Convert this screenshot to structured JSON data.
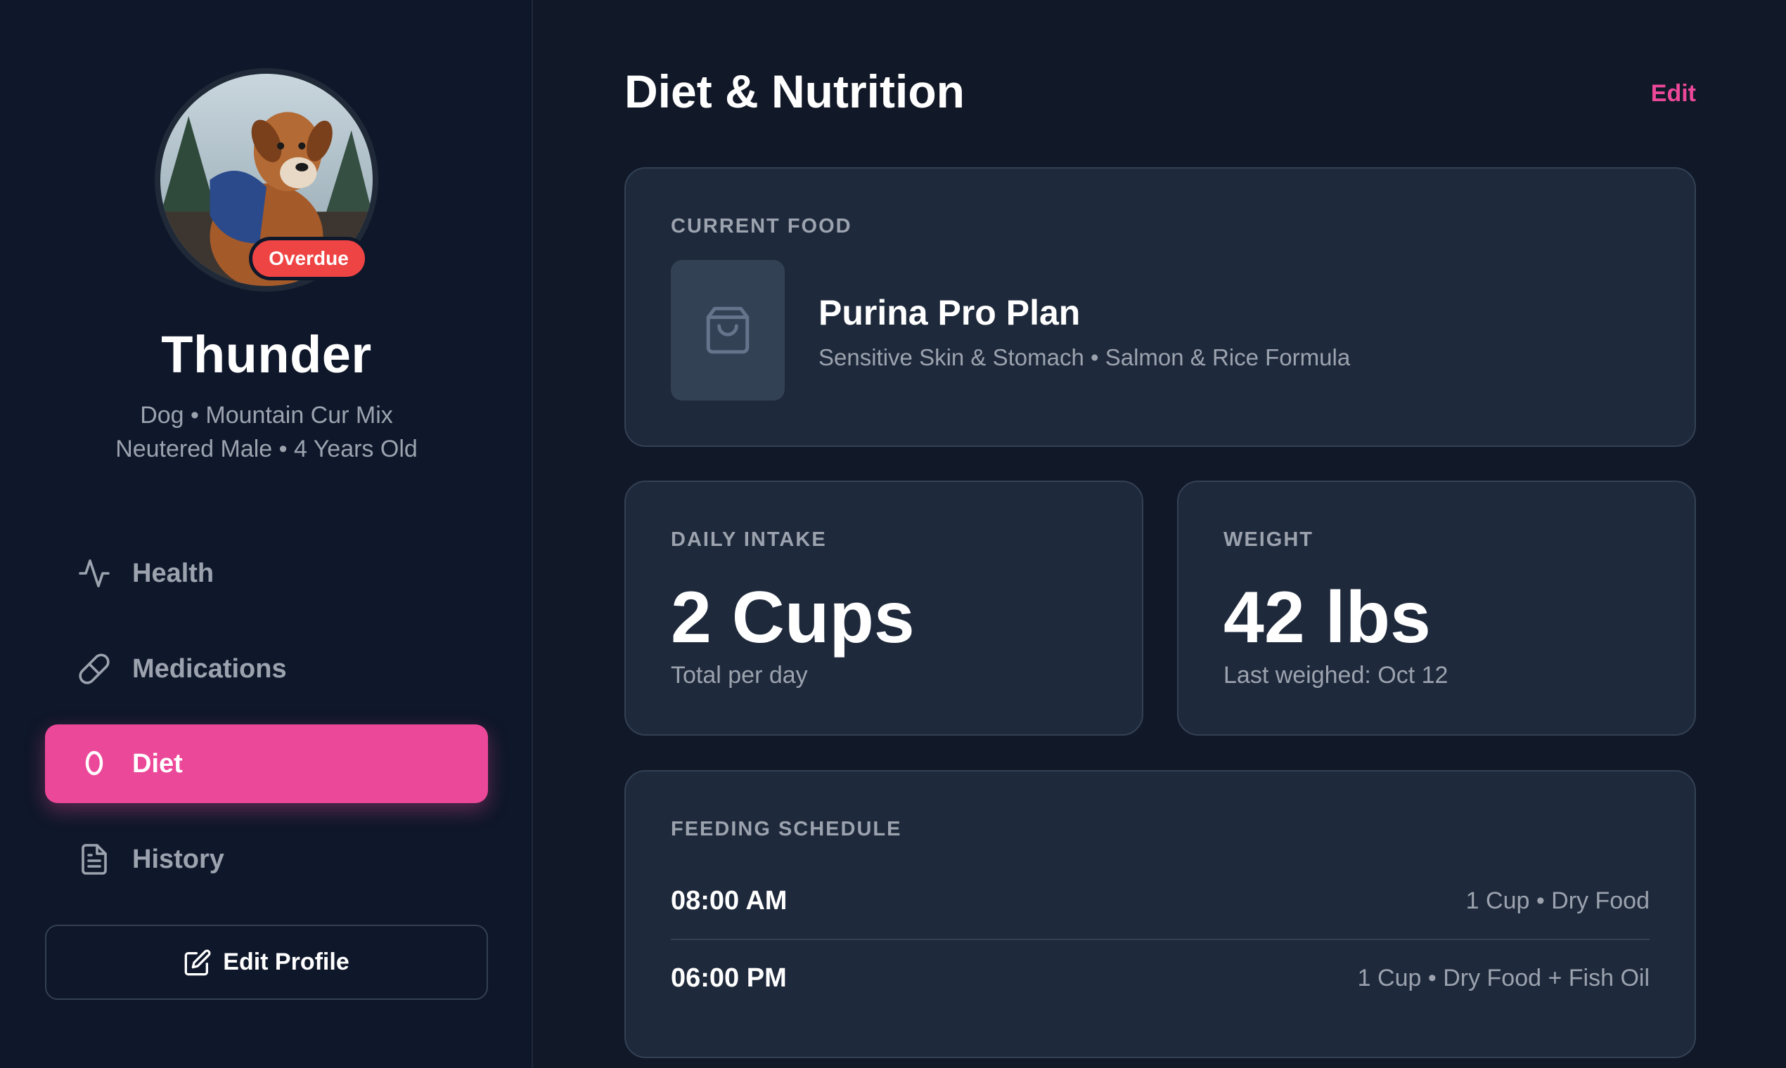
{
  "profile": {
    "name": "Thunder",
    "status_badge": "Overdue",
    "species_breed": "Dog • Mountain Cur Mix",
    "sex_age": "Neutered Male • 4 Years Old"
  },
  "nav": {
    "items": [
      {
        "label": "Health",
        "icon": "activity-icon",
        "active": false
      },
      {
        "label": "Medications",
        "icon": "pill-icon",
        "active": false
      },
      {
        "label": "Diet",
        "icon": "droplet-icon",
        "active": true
      },
      {
        "label": "History",
        "icon": "document-icon",
        "active": false
      }
    ],
    "edit_profile_label": "Edit Profile"
  },
  "main": {
    "title": "Diet & Nutrition",
    "edit_label": "Edit",
    "current_food": {
      "label": "CURRENT FOOD",
      "name": "Purina Pro Plan",
      "description": "Sensitive Skin & Stomach • Salmon & Rice Formula"
    },
    "daily_intake": {
      "label": "DAILY INTAKE",
      "value": "2 Cups",
      "subtext": "Total per day"
    },
    "weight": {
      "label": "WEIGHT",
      "value": "42 lbs",
      "subtext": "Last weighed: Oct 12"
    },
    "feeding_schedule": {
      "label": "FEEDING SCHEDULE",
      "rows": [
        {
          "time": "08:00 AM",
          "detail": "1 Cup • Dry Food"
        },
        {
          "time": "06:00 PM",
          "detail": "1 Cup • Dry Food + Fish Oil"
        }
      ]
    }
  },
  "colors": {
    "background": "#111827",
    "sidebar": "#0f172a",
    "card": "#1e293b",
    "accent": "#ec4899",
    "danger": "#ef4444",
    "muted_text": "#9ca3af"
  }
}
